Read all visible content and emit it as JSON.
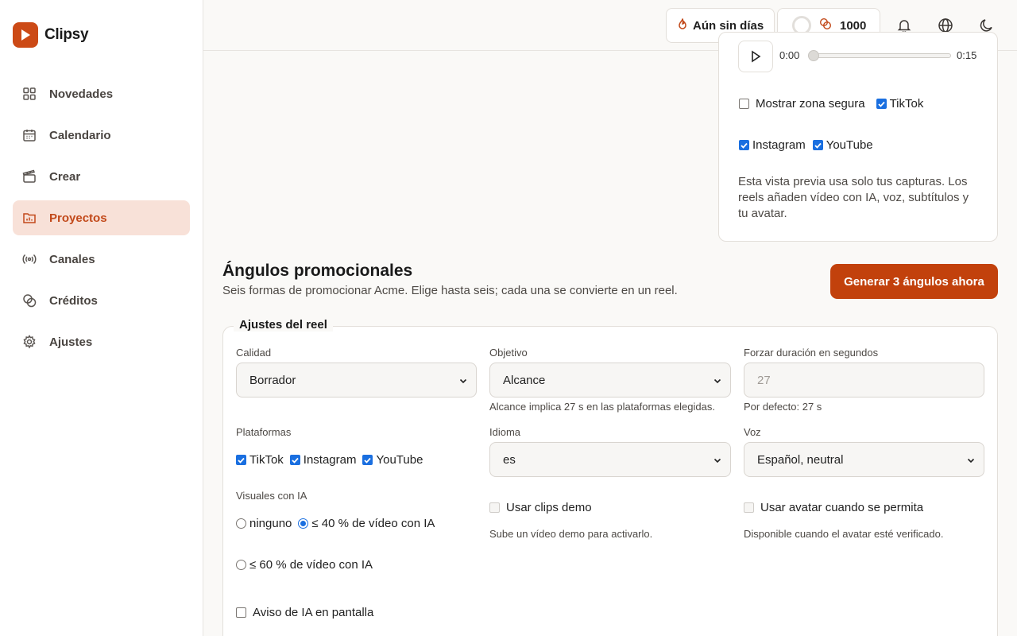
{
  "app": {
    "name": "Clipsy",
    "brand_color": "#cc4a16"
  },
  "sidebar": {
    "items": [
      {
        "label": "Novedades",
        "icon": "grid-icon",
        "active": false
      },
      {
        "label": "Calendario",
        "icon": "calendar-icon",
        "active": false
      },
      {
        "label": "Crear",
        "icon": "clapperboard-icon",
        "active": false
      },
      {
        "label": "Proyectos",
        "icon": "folder-chart-icon",
        "active": true
      },
      {
        "label": "Canales",
        "icon": "broadcast-icon",
        "active": false
      },
      {
        "label": "Créditos",
        "icon": "coins-icon",
        "active": false
      },
      {
        "label": "Ajustes",
        "icon": "gear-icon",
        "active": false
      }
    ]
  },
  "header": {
    "streak_label": "Aún sin días",
    "credits": "1000",
    "icons": [
      "bell-icon",
      "globe-icon",
      "moon-icon"
    ]
  },
  "preview": {
    "time_current": "0:00",
    "time_total": "0:15",
    "progress": 0,
    "safe_zone_label": "Mostrar zona segura",
    "safe_zone_checked": false,
    "platforms": [
      {
        "label": "TikTok",
        "checked": true
      },
      {
        "label": "Instagram",
        "checked": true
      },
      {
        "label": "YouTube",
        "checked": true
      }
    ],
    "note": "Esta vista previa usa solo tus capturas. Los reels añaden vídeo con IA, voz, subtítulos y tu avatar."
  },
  "section": {
    "title": "Ángulos promocionales",
    "subtitle": "Seis formas de promocionar Acme. Elige hasta seis; cada una se convierte en un reel.",
    "generate_button": "Generar 3 ángulos ahora"
  },
  "settings": {
    "legend": "Ajustes del reel",
    "quality": {
      "label": "Calidad",
      "value": "Borrador"
    },
    "objective": {
      "label": "Objetivo",
      "value": "Alcance",
      "hint": "Alcance implica 27 s en las plataformas elegidas."
    },
    "duration": {
      "label": "Forzar duración en segundos",
      "placeholder": "27",
      "hint": "Por defecto: 27 s"
    },
    "platforms": {
      "label": "Plataformas",
      "options": [
        {
          "label": "TikTok",
          "checked": true
        },
        {
          "label": "Instagram",
          "checked": true
        },
        {
          "label": "YouTube",
          "checked": true
        }
      ]
    },
    "language": {
      "label": "Idioma",
      "value": "es"
    },
    "voice": {
      "label": "Voz",
      "value": "Español, neutral"
    },
    "ai_visuals": {
      "label": "Visuales con IA",
      "options": [
        {
          "label": "ninguno",
          "selected": false
        },
        {
          "label": "≤ 40 % de vídeo con IA",
          "selected": true
        },
        {
          "label": "≤ 60 % de vídeo con IA",
          "selected": false
        }
      ]
    },
    "demo_clips": {
      "label": "Usar clips demo",
      "checked": false,
      "disabled": true,
      "hint": "Sube un vídeo demo para activarlo."
    },
    "avatar": {
      "label": "Usar avatar cuando se permita",
      "checked": false,
      "disabled": true,
      "hint": "Disponible cuando el avatar esté verificado."
    },
    "ai_notice": {
      "label": "Aviso de IA en pantalla",
      "checked": false
    }
  }
}
